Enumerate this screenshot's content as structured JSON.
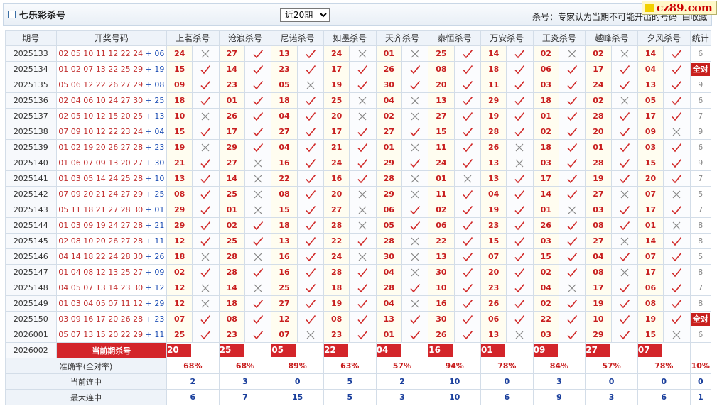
{
  "header": {
    "title": "七乐彩杀号",
    "period_select": "近20期",
    "period_options": [
      "近20期"
    ],
    "note": "杀号：专家认为当期不可能开出的号码",
    "favorite": "收藏"
  },
  "logo": {
    "text": "cz89.com"
  },
  "table": {
    "columns": [
      "期号",
      "开奖号码",
      "上茗杀号",
      "沧浪杀号",
      "尼诺杀号",
      "如墨杀号",
      "天齐杀号",
      "泰恒杀号",
      "万安杀号",
      "正炎杀号",
      "越峰杀号",
      "夕风杀号",
      "统计"
    ],
    "rows": [
      {
        "period": "2025133",
        "main": "02 05 10 11 12 22 24",
        "special": "06",
        "picks": [
          [
            "24",
            0
          ],
          [
            "27",
            1
          ],
          [
            "13",
            1
          ],
          [
            "24",
            0
          ],
          [
            "01",
            0
          ],
          [
            "25",
            1
          ],
          [
            "14",
            1
          ],
          [
            "02",
            0
          ],
          [
            "02",
            0
          ],
          [
            "14",
            1
          ]
        ],
        "stat": "6"
      },
      {
        "period": "2025134",
        "main": "01 02 07 13 22 25 29",
        "special": "19",
        "picks": [
          [
            "15",
            1
          ],
          [
            "14",
            1
          ],
          [
            "23",
            1
          ],
          [
            "17",
            1
          ],
          [
            "26",
            1
          ],
          [
            "08",
            1
          ],
          [
            "18",
            1
          ],
          [
            "06",
            1
          ],
          [
            "17",
            1
          ],
          [
            "04",
            1
          ]
        ],
        "stat": "全对"
      },
      {
        "period": "2025135",
        "main": "05 06 12 22 26 27 29",
        "special": "08",
        "picks": [
          [
            "09",
            1
          ],
          [
            "23",
            1
          ],
          [
            "05",
            0
          ],
          [
            "19",
            1
          ],
          [
            "30",
            1
          ],
          [
            "20",
            1
          ],
          [
            "11",
            1
          ],
          [
            "03",
            1
          ],
          [
            "24",
            1
          ],
          [
            "13",
            1
          ]
        ],
        "stat": "9"
      },
      {
        "period": "2025136",
        "main": "02 04 06 10 24 27 30",
        "special": "25",
        "picks": [
          [
            "18",
            1
          ],
          [
            "01",
            1
          ],
          [
            "18",
            1
          ],
          [
            "25",
            0
          ],
          [
            "04",
            0
          ],
          [
            "13",
            1
          ],
          [
            "29",
            1
          ],
          [
            "18",
            1
          ],
          [
            "02",
            0
          ],
          [
            "05",
            1
          ]
        ],
        "stat": "6"
      },
      {
        "period": "2025137",
        "main": "02 05 10 12 15 20 25",
        "special": "13",
        "picks": [
          [
            "10",
            0
          ],
          [
            "26",
            1
          ],
          [
            "04",
            1
          ],
          [
            "20",
            0
          ],
          [
            "02",
            0
          ],
          [
            "27",
            1
          ],
          [
            "19",
            1
          ],
          [
            "01",
            1
          ],
          [
            "28",
            1
          ],
          [
            "17",
            1
          ]
        ],
        "stat": "7"
      },
      {
        "period": "2025138",
        "main": "07 09 10 12 22 23 24",
        "special": "04",
        "picks": [
          [
            "15",
            1
          ],
          [
            "17",
            1
          ],
          [
            "27",
            1
          ],
          [
            "17",
            1
          ],
          [
            "27",
            1
          ],
          [
            "15",
            1
          ],
          [
            "28",
            1
          ],
          [
            "02",
            1
          ],
          [
            "20",
            1
          ],
          [
            "09",
            0
          ]
        ],
        "stat": "9"
      },
      {
        "period": "2025139",
        "main": "01 02 19 20 26 27 28",
        "special": "23",
        "picks": [
          [
            "19",
            0
          ],
          [
            "29",
            1
          ],
          [
            "04",
            1
          ],
          [
            "21",
            1
          ],
          [
            "01",
            0
          ],
          [
            "11",
            1
          ],
          [
            "26",
            0
          ],
          [
            "18",
            1
          ],
          [
            "01",
            1
          ],
          [
            "03",
            1
          ]
        ],
        "stat": "6"
      },
      {
        "period": "2025140",
        "main": "01 06 07 09 13 20 27",
        "special": "30",
        "picks": [
          [
            "21",
            1
          ],
          [
            "27",
            0
          ],
          [
            "16",
            1
          ],
          [
            "24",
            1
          ],
          [
            "29",
            1
          ],
          [
            "24",
            1
          ],
          [
            "13",
            0
          ],
          [
            "03",
            1
          ],
          [
            "28",
            1
          ],
          [
            "15",
            1
          ]
        ],
        "stat": "9"
      },
      {
        "period": "2025141",
        "main": "01 03 05 14 24 25 28",
        "special": "10",
        "picks": [
          [
            "13",
            1
          ],
          [
            "14",
            0
          ],
          [
            "22",
            1
          ],
          [
            "16",
            1
          ],
          [
            "28",
            0
          ],
          [
            "01",
            0
          ],
          [
            "13",
            1
          ],
          [
            "17",
            1
          ],
          [
            "19",
            1
          ],
          [
            "20",
            1
          ]
        ],
        "stat": "7"
      },
      {
        "period": "2025142",
        "main": "07 09 20 21 24 27 29",
        "special": "25",
        "picks": [
          [
            "08",
            1
          ],
          [
            "25",
            0
          ],
          [
            "08",
            1
          ],
          [
            "20",
            0
          ],
          [
            "29",
            0
          ],
          [
            "11",
            1
          ],
          [
            "04",
            1
          ],
          [
            "14",
            1
          ],
          [
            "27",
            0
          ],
          [
            "07",
            0
          ]
        ],
        "stat": "5"
      },
      {
        "period": "2025143",
        "main": "05 11 18 21 27 28 30",
        "special": "01",
        "picks": [
          [
            "29",
            1
          ],
          [
            "01",
            0
          ],
          [
            "15",
            1
          ],
          [
            "27",
            0
          ],
          [
            "06",
            1
          ],
          [
            "02",
            1
          ],
          [
            "19",
            1
          ],
          [
            "01",
            0
          ],
          [
            "03",
            1
          ],
          [
            "17",
            1
          ]
        ],
        "stat": "7"
      },
      {
        "period": "2025144",
        "main": "01 03 09 19 24 27 28",
        "special": "21",
        "picks": [
          [
            "29",
            1
          ],
          [
            "02",
            1
          ],
          [
            "18",
            1
          ],
          [
            "28",
            0
          ],
          [
            "05",
            1
          ],
          [
            "06",
            1
          ],
          [
            "23",
            1
          ],
          [
            "26",
            1
          ],
          [
            "08",
            1
          ],
          [
            "01",
            0
          ]
        ],
        "stat": "8"
      },
      {
        "period": "2025145",
        "main": "02 08 10 20 26 27 28",
        "special": "11",
        "picks": [
          [
            "12",
            1
          ],
          [
            "25",
            1
          ],
          [
            "13",
            1
          ],
          [
            "22",
            1
          ],
          [
            "28",
            0
          ],
          [
            "22",
            1
          ],
          [
            "15",
            1
          ],
          [
            "03",
            1
          ],
          [
            "27",
            0
          ],
          [
            "14",
            1
          ]
        ],
        "stat": "8"
      },
      {
        "period": "2025146",
        "main": "04 14 18 22 24 28 30",
        "special": "26",
        "picks": [
          [
            "18",
            0
          ],
          [
            "28",
            0
          ],
          [
            "16",
            1
          ],
          [
            "24",
            0
          ],
          [
            "30",
            0
          ],
          [
            "13",
            1
          ],
          [
            "07",
            1
          ],
          [
            "15",
            1
          ],
          [
            "04",
            1
          ],
          [
            "07",
            1
          ]
        ],
        "stat": "5"
      },
      {
        "period": "2025147",
        "main": "01 04 08 12 13 25 27",
        "special": "09",
        "picks": [
          [
            "02",
            1
          ],
          [
            "28",
            1
          ],
          [
            "16",
            1
          ],
          [
            "28",
            1
          ],
          [
            "04",
            0
          ],
          [
            "30",
            1
          ],
          [
            "20",
            1
          ],
          [
            "02",
            1
          ],
          [
            "08",
            0
          ],
          [
            "17",
            1
          ]
        ],
        "stat": "8"
      },
      {
        "period": "2025148",
        "main": "04 05 07 13 14 23 30",
        "special": "12",
        "picks": [
          [
            "12",
            0
          ],
          [
            "14",
            0
          ],
          [
            "25",
            1
          ],
          [
            "18",
            1
          ],
          [
            "28",
            1
          ],
          [
            "10",
            1
          ],
          [
            "23",
            1
          ],
          [
            "04",
            0
          ],
          [
            "17",
            1
          ],
          [
            "06",
            1
          ]
        ],
        "stat": "7"
      },
      {
        "period": "2025149",
        "main": "01 03 04 05 07 11 12",
        "special": "29",
        "picks": [
          [
            "12",
            0
          ],
          [
            "18",
            1
          ],
          [
            "27",
            1
          ],
          [
            "19",
            1
          ],
          [
            "04",
            0
          ],
          [
            "16",
            1
          ],
          [
            "26",
            1
          ],
          [
            "02",
            1
          ],
          [
            "19",
            1
          ],
          [
            "08",
            1
          ]
        ],
        "stat": "8"
      },
      {
        "period": "2025150",
        "main": "03 09 16 17 20 26 28",
        "special": "23",
        "picks": [
          [
            "07",
            1
          ],
          [
            "08",
            1
          ],
          [
            "12",
            1
          ],
          [
            "08",
            1
          ],
          [
            "13",
            1
          ],
          [
            "30",
            1
          ],
          [
            "06",
            1
          ],
          [
            "22",
            1
          ],
          [
            "10",
            1
          ],
          [
            "19",
            1
          ]
        ],
        "stat": "全对"
      },
      {
        "period": "2026001",
        "main": "05 07 13 15 20 22 29",
        "special": "11",
        "picks": [
          [
            "25",
            1
          ],
          [
            "23",
            1
          ],
          [
            "07",
            0
          ],
          [
            "23",
            1
          ],
          [
            "01",
            1
          ],
          [
            "26",
            1
          ],
          [
            "13",
            0
          ],
          [
            "03",
            1
          ],
          [
            "29",
            1
          ],
          [
            "15",
            0
          ]
        ],
        "stat": "6"
      }
    ],
    "current": {
      "period": "2026002",
      "label": "当前期杀号",
      "picks": [
        "20",
        "25",
        "05",
        "22",
        "04",
        "16",
        "01",
        "09",
        "27",
        "07"
      ]
    },
    "summary": [
      {
        "label": "准确率(全对率)",
        "values": [
          "68%",
          "68%",
          "89%",
          "63%",
          "57%",
          "94%",
          "78%",
          "84%",
          "57%",
          "78%",
          "10%"
        ],
        "style": "acc"
      },
      {
        "label": "当前连中",
        "values": [
          "2",
          "3",
          "0",
          "5",
          "2",
          "10",
          "0",
          "3",
          "0",
          "0",
          "0"
        ],
        "style": "blue"
      },
      {
        "label": "最大连中",
        "values": [
          "6",
          "7",
          "15",
          "5",
          "3",
          "10",
          "6",
          "9",
          "3",
          "6",
          "1"
        ],
        "style": "blue"
      }
    ]
  },
  "colors": {
    "hit": "#d12a2a",
    "miss": "#8a8a8a",
    "accent": "#d3252a"
  },
  "icons": {
    "hit": "check-icon",
    "miss": "cross-icon"
  }
}
